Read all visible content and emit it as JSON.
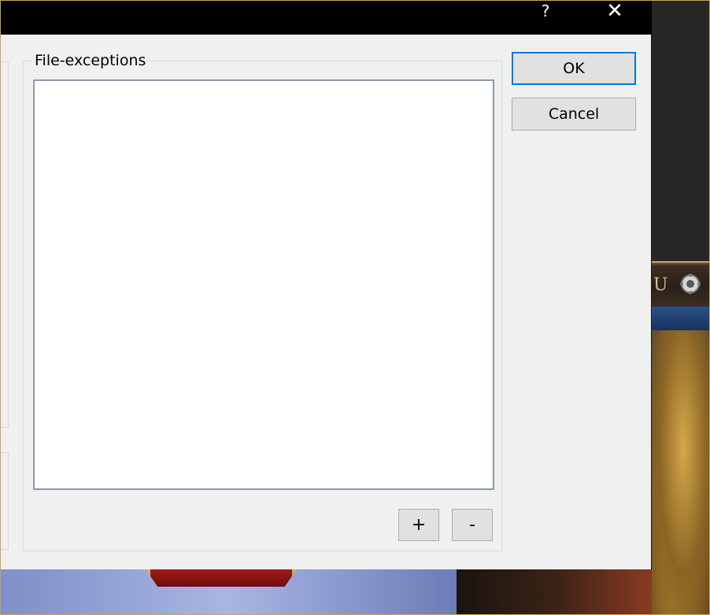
{
  "titlebar": {
    "help_glyph": "?",
    "close_glyph": "✕"
  },
  "file_exceptions": {
    "label": "File-exceptions",
    "items": []
  },
  "buttons": {
    "ok_label": "OK",
    "cancel_label": "Cancel",
    "add_label": "+",
    "remove_label": "-"
  },
  "background": {
    "partial_text": "U",
    "icon": "gear-icon"
  },
  "colors": {
    "titlebar": "#000000",
    "dialog": "#f0f0f0",
    "focus_border": "#0078d7",
    "background_accent": "#c9a45a"
  }
}
